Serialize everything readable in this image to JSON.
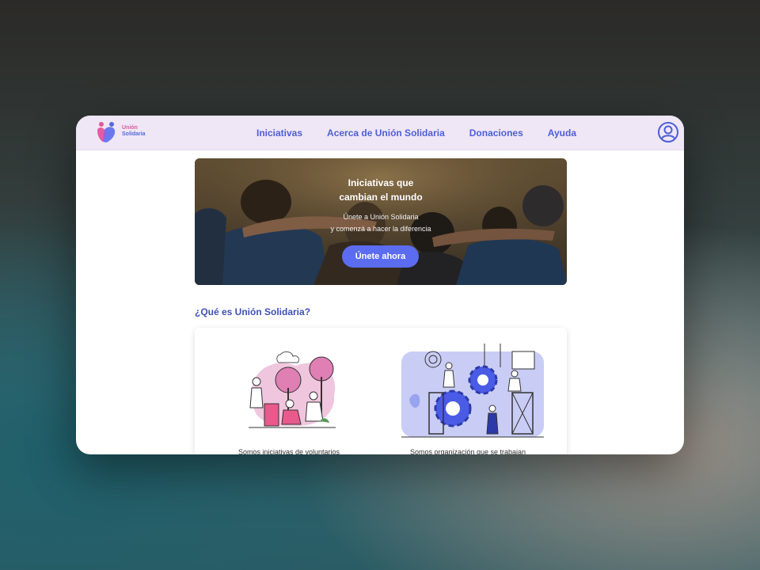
{
  "brand": {
    "name_line1": "Unión",
    "name_line2": "Solidaria"
  },
  "nav": {
    "items": [
      {
        "label": "Iniciativas"
      },
      {
        "label": "Acerca de Unión Solidaria"
      },
      {
        "label": "Donaciones"
      },
      {
        "label": "Ayuda"
      }
    ]
  },
  "hero": {
    "title_line1": "Iniciativas que",
    "title_line2": "cambian el mundo",
    "subtitle_line1": "Únete a Unión Solidaria",
    "subtitle_line2": "y comenzá a hacer la diferencia",
    "cta_label": "Únete ahora"
  },
  "about": {
    "title": "¿Qué es Unión Solidaria?",
    "card_left_text": "Somos iniciativas de voluntarios",
    "card_right_text": "Somos organización que se trabajan"
  },
  "icons": {
    "logo": "heart-logo-icon",
    "profile": "user-profile-icon",
    "illustration_left": "volunteers-planting-illustration",
    "illustration_right": "teamwork-gears-illustration"
  },
  "colors": {
    "accent": "#5b6cf0",
    "nav_text": "#4d5fd6",
    "nav_bg": "#efe6f6",
    "brand_pink": "#e0579a"
  }
}
